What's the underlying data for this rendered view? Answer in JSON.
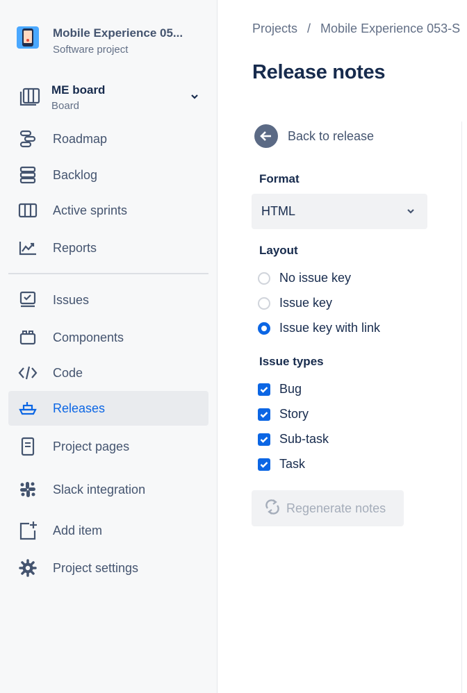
{
  "project": {
    "name": "Mobile Experience 05...",
    "type": "Software project"
  },
  "board": {
    "name": "ME board",
    "subtitle": "Board"
  },
  "nav": {
    "roadmap": "Roadmap",
    "backlog": "Backlog",
    "active_sprints": "Active sprints",
    "reports": "Reports",
    "issues": "Issues",
    "components": "Components",
    "code": "Code",
    "releases": "Releases",
    "project_pages": "Project pages",
    "slack": "Slack integration",
    "add_item": "Add item",
    "project_settings": "Project settings"
  },
  "breadcrumb": {
    "projects": "Projects",
    "separator": "/",
    "current": "Mobile Experience 053-S"
  },
  "page": {
    "title": "Release notes",
    "back_label": "Back to release"
  },
  "format": {
    "label": "Format",
    "selected": "HTML"
  },
  "layout": {
    "label": "Layout",
    "options": [
      {
        "label": "No issue key",
        "selected": false
      },
      {
        "label": "Issue key",
        "selected": false
      },
      {
        "label": "Issue key with link",
        "selected": true
      }
    ]
  },
  "issue_types": {
    "label": "Issue types",
    "options": [
      {
        "label": "Bug",
        "checked": true
      },
      {
        "label": "Story",
        "checked": true
      },
      {
        "label": "Sub-task",
        "checked": true
      },
      {
        "label": "Task",
        "checked": true
      }
    ]
  },
  "regenerate": {
    "label": "Regenerate notes",
    "disabled": true
  },
  "colors": {
    "accent": "#0c66e4",
    "sidebar_bg": "#f7f8f9",
    "active_bg": "#e9ebee"
  }
}
